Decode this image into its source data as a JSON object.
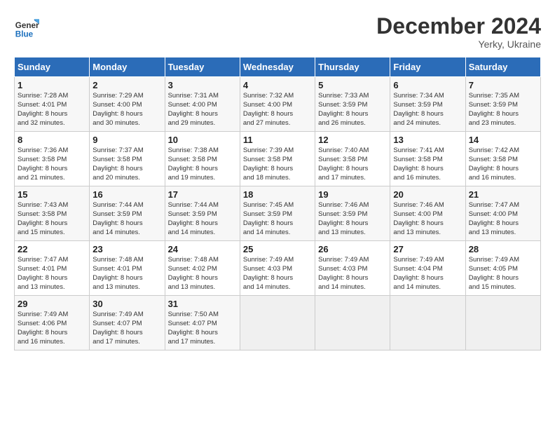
{
  "header": {
    "logo_line1": "General",
    "logo_line2": "Blue",
    "month": "December 2024",
    "location": "Yerky, Ukraine"
  },
  "weekdays": [
    "Sunday",
    "Monday",
    "Tuesday",
    "Wednesday",
    "Thursday",
    "Friday",
    "Saturday"
  ],
  "weeks": [
    [
      {
        "day": "1",
        "lines": [
          "Sunrise: 7:28 AM",
          "Sunset: 4:01 PM",
          "Daylight: 8 hours",
          "and 32 minutes."
        ]
      },
      {
        "day": "2",
        "lines": [
          "Sunrise: 7:29 AM",
          "Sunset: 4:00 PM",
          "Daylight: 8 hours",
          "and 30 minutes."
        ]
      },
      {
        "day": "3",
        "lines": [
          "Sunrise: 7:31 AM",
          "Sunset: 4:00 PM",
          "Daylight: 8 hours",
          "and 29 minutes."
        ]
      },
      {
        "day": "4",
        "lines": [
          "Sunrise: 7:32 AM",
          "Sunset: 4:00 PM",
          "Daylight: 8 hours",
          "and 27 minutes."
        ]
      },
      {
        "day": "5",
        "lines": [
          "Sunrise: 7:33 AM",
          "Sunset: 3:59 PM",
          "Daylight: 8 hours",
          "and 26 minutes."
        ]
      },
      {
        "day": "6",
        "lines": [
          "Sunrise: 7:34 AM",
          "Sunset: 3:59 PM",
          "Daylight: 8 hours",
          "and 24 minutes."
        ]
      },
      {
        "day": "7",
        "lines": [
          "Sunrise: 7:35 AM",
          "Sunset: 3:59 PM",
          "Daylight: 8 hours",
          "and 23 minutes."
        ]
      }
    ],
    [
      {
        "day": "8",
        "lines": [
          "Sunrise: 7:36 AM",
          "Sunset: 3:58 PM",
          "Daylight: 8 hours",
          "and 21 minutes."
        ]
      },
      {
        "day": "9",
        "lines": [
          "Sunrise: 7:37 AM",
          "Sunset: 3:58 PM",
          "Daylight: 8 hours",
          "and 20 minutes."
        ]
      },
      {
        "day": "10",
        "lines": [
          "Sunrise: 7:38 AM",
          "Sunset: 3:58 PM",
          "Daylight: 8 hours",
          "and 19 minutes."
        ]
      },
      {
        "day": "11",
        "lines": [
          "Sunrise: 7:39 AM",
          "Sunset: 3:58 PM",
          "Daylight: 8 hours",
          "and 18 minutes."
        ]
      },
      {
        "day": "12",
        "lines": [
          "Sunrise: 7:40 AM",
          "Sunset: 3:58 PM",
          "Daylight: 8 hours",
          "and 17 minutes."
        ]
      },
      {
        "day": "13",
        "lines": [
          "Sunrise: 7:41 AM",
          "Sunset: 3:58 PM",
          "Daylight: 8 hours",
          "and 16 minutes."
        ]
      },
      {
        "day": "14",
        "lines": [
          "Sunrise: 7:42 AM",
          "Sunset: 3:58 PM",
          "Daylight: 8 hours",
          "and 16 minutes."
        ]
      }
    ],
    [
      {
        "day": "15",
        "lines": [
          "Sunrise: 7:43 AM",
          "Sunset: 3:58 PM",
          "Daylight: 8 hours",
          "and 15 minutes."
        ]
      },
      {
        "day": "16",
        "lines": [
          "Sunrise: 7:44 AM",
          "Sunset: 3:59 PM",
          "Daylight: 8 hours",
          "and 14 minutes."
        ]
      },
      {
        "day": "17",
        "lines": [
          "Sunrise: 7:44 AM",
          "Sunset: 3:59 PM",
          "Daylight: 8 hours",
          "and 14 minutes."
        ]
      },
      {
        "day": "18",
        "lines": [
          "Sunrise: 7:45 AM",
          "Sunset: 3:59 PM",
          "Daylight: 8 hours",
          "and 14 minutes."
        ]
      },
      {
        "day": "19",
        "lines": [
          "Sunrise: 7:46 AM",
          "Sunset: 3:59 PM",
          "Daylight: 8 hours",
          "and 13 minutes."
        ]
      },
      {
        "day": "20",
        "lines": [
          "Sunrise: 7:46 AM",
          "Sunset: 4:00 PM",
          "Daylight: 8 hours",
          "and 13 minutes."
        ]
      },
      {
        "day": "21",
        "lines": [
          "Sunrise: 7:47 AM",
          "Sunset: 4:00 PM",
          "Daylight: 8 hours",
          "and 13 minutes."
        ]
      }
    ],
    [
      {
        "day": "22",
        "lines": [
          "Sunrise: 7:47 AM",
          "Sunset: 4:01 PM",
          "Daylight: 8 hours",
          "and 13 minutes."
        ]
      },
      {
        "day": "23",
        "lines": [
          "Sunrise: 7:48 AM",
          "Sunset: 4:01 PM",
          "Daylight: 8 hours",
          "and 13 minutes."
        ]
      },
      {
        "day": "24",
        "lines": [
          "Sunrise: 7:48 AM",
          "Sunset: 4:02 PM",
          "Daylight: 8 hours",
          "and 13 minutes."
        ]
      },
      {
        "day": "25",
        "lines": [
          "Sunrise: 7:49 AM",
          "Sunset: 4:03 PM",
          "Daylight: 8 hours",
          "and 14 minutes."
        ]
      },
      {
        "day": "26",
        "lines": [
          "Sunrise: 7:49 AM",
          "Sunset: 4:03 PM",
          "Daylight: 8 hours",
          "and 14 minutes."
        ]
      },
      {
        "day": "27",
        "lines": [
          "Sunrise: 7:49 AM",
          "Sunset: 4:04 PM",
          "Daylight: 8 hours",
          "and 14 minutes."
        ]
      },
      {
        "day": "28",
        "lines": [
          "Sunrise: 7:49 AM",
          "Sunset: 4:05 PM",
          "Daylight: 8 hours",
          "and 15 minutes."
        ]
      }
    ],
    [
      {
        "day": "29",
        "lines": [
          "Sunrise: 7:49 AM",
          "Sunset: 4:06 PM",
          "Daylight: 8 hours",
          "and 16 minutes."
        ]
      },
      {
        "day": "30",
        "lines": [
          "Sunrise: 7:49 AM",
          "Sunset: 4:07 PM",
          "Daylight: 8 hours",
          "and 17 minutes."
        ]
      },
      {
        "day": "31",
        "lines": [
          "Sunrise: 7:50 AM",
          "Sunset: 4:07 PM",
          "Daylight: 8 hours",
          "and 17 minutes."
        ]
      },
      null,
      null,
      null,
      null
    ]
  ]
}
